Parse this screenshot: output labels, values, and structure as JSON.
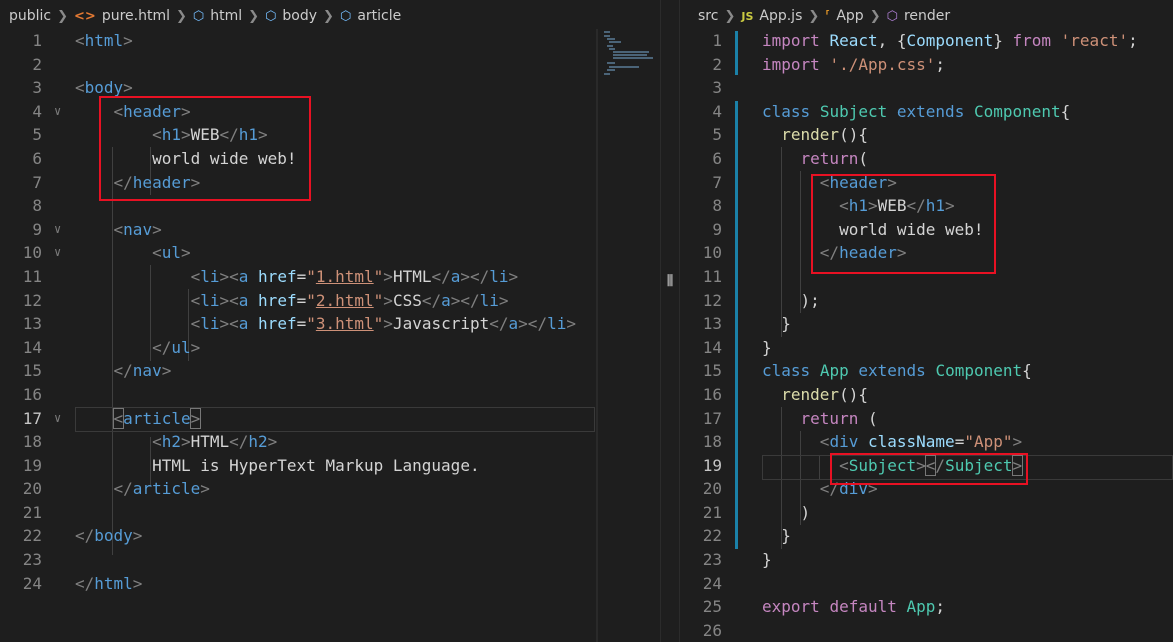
{
  "left_editor": {
    "breadcrumb": [
      {
        "label": "public",
        "icon": ""
      },
      {
        "label": "pure.html",
        "icon": "html-file-icon"
      },
      {
        "label": "html",
        "icon": "element-icon"
      },
      {
        "label": "body",
        "icon": "element-icon"
      },
      {
        "label": "article",
        "icon": "element-icon"
      }
    ],
    "line_numbers": [
      "1",
      "2",
      "3",
      "4",
      "5",
      "6",
      "7",
      "8",
      "9",
      "10",
      "11",
      "12",
      "13",
      "14",
      "15",
      "16",
      "17",
      "18",
      "19",
      "20",
      "21",
      "22",
      "23",
      "24"
    ],
    "active_line": "17",
    "code": {
      "html_open": "html",
      "body_open": "body",
      "header_open": "header",
      "h1_tag": "h1",
      "h1_text": "WEB",
      "header_text": "world wide web!",
      "header_close": "header",
      "nav_open": "nav",
      "ul_open": "ul",
      "li_tag": "li",
      "a_tag": "a",
      "href_attr": "href",
      "links": [
        {
          "href": "1.html",
          "text": "HTML"
        },
        {
          "href": "2.html",
          "text": "CSS"
        },
        {
          "href": "3.html",
          "text": "Javascript"
        }
      ],
      "ul_close": "ul",
      "nav_close": "nav",
      "article_open": "article",
      "h2_tag": "h2",
      "h2_text": "HTML",
      "article_text": "HTML is HyperText Markup Language.",
      "article_close": "article",
      "body_close": "body",
      "html_close": "html"
    }
  },
  "split_handle": "⦀",
  "right_editor": {
    "breadcrumb": [
      {
        "label": "src",
        "icon": ""
      },
      {
        "label": "App.js",
        "icon": "js-file-icon"
      },
      {
        "label": "App",
        "icon": "class-icon"
      },
      {
        "label": "render",
        "icon": "method-icon"
      }
    ],
    "line_numbers": [
      "1",
      "2",
      "3",
      "4",
      "5",
      "6",
      "7",
      "8",
      "9",
      "10",
      "11",
      "12",
      "13",
      "14",
      "15",
      "16",
      "17",
      "18",
      "19",
      "20",
      "21",
      "22",
      "23",
      "24",
      "25",
      "26"
    ],
    "active_line": "19",
    "code": {
      "import_kw": "import",
      "react": "React",
      "component": "Component",
      "from_kw": "from",
      "react_str": "'react'",
      "css_str": "'./App.css'",
      "class_kw": "class",
      "subject": "Subject",
      "extends_kw": "extends",
      "render": "render",
      "return_kw": "return",
      "header": "header",
      "h1": "h1",
      "h1_text": "WEB",
      "header_text": "world wide web!",
      "app": "App",
      "div": "div",
      "classname_attr": "className",
      "app_str": "\"App\"",
      "export_kw": "export",
      "default_kw": "default"
    }
  },
  "colors": {
    "background": "#1e1e1e",
    "tag": "#569cd6",
    "attribute": "#9cdcfe",
    "string": "#ce9178",
    "keyword_control": "#c586c0",
    "class_name": "#4ec9b0",
    "function": "#dcdcaa",
    "highlight_box": "#e81123",
    "modified_gutter": "#1b81a8"
  }
}
